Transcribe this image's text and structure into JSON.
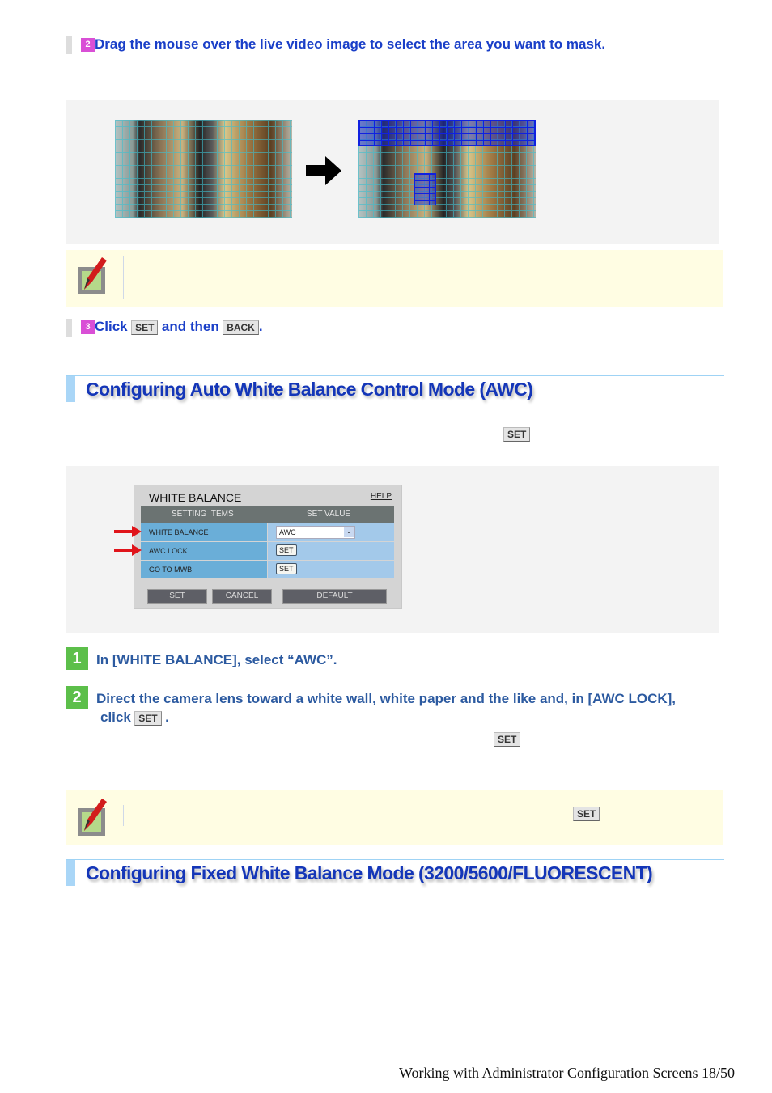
{
  "step2_mask": {
    "number": "2",
    "text": "Drag the mouse over the live video image to select the area you want to mask."
  },
  "step3_mask": {
    "number": "3",
    "text_click": "Click",
    "set_label": "SET",
    "text_and_then": "and then",
    "back_label": "BACK",
    "period": "."
  },
  "section_awc": {
    "title": "Configuring Auto White Balance Control Mode (AWC)",
    "set_label": "SET"
  },
  "wb_panel": {
    "title": "WHITE BALANCE",
    "help": "HELP",
    "col_items": "SETTING ITEMS",
    "col_value": "SET VALUE",
    "rows": [
      {
        "label": "WHITE BALANCE",
        "value": "AWC"
      },
      {
        "label": "AWC LOCK",
        "value": "SET"
      },
      {
        "label": "GO TO MWB",
        "value": "SET"
      }
    ],
    "buttons": {
      "set": "SET",
      "cancel": "CANCEL",
      "default": "DEFAULT"
    }
  },
  "steps": [
    {
      "number": "1",
      "text": "In [WHITE BALANCE], select “AWC”."
    },
    {
      "number": "2",
      "text": "Direct the camera lens toward a white wall, white paper and the like and, in [AWC LOCK],",
      "text2": "click",
      "set_label": "SET",
      "period": "."
    }
  ],
  "loose_set_label": "SET",
  "note_set_label": "SET",
  "section_fixed": {
    "title": "Configuring Fixed White Balance Mode (3200/5600/FLUORESCENT)"
  },
  "footer": "Working with Administrator Configuration Screens 18/50"
}
